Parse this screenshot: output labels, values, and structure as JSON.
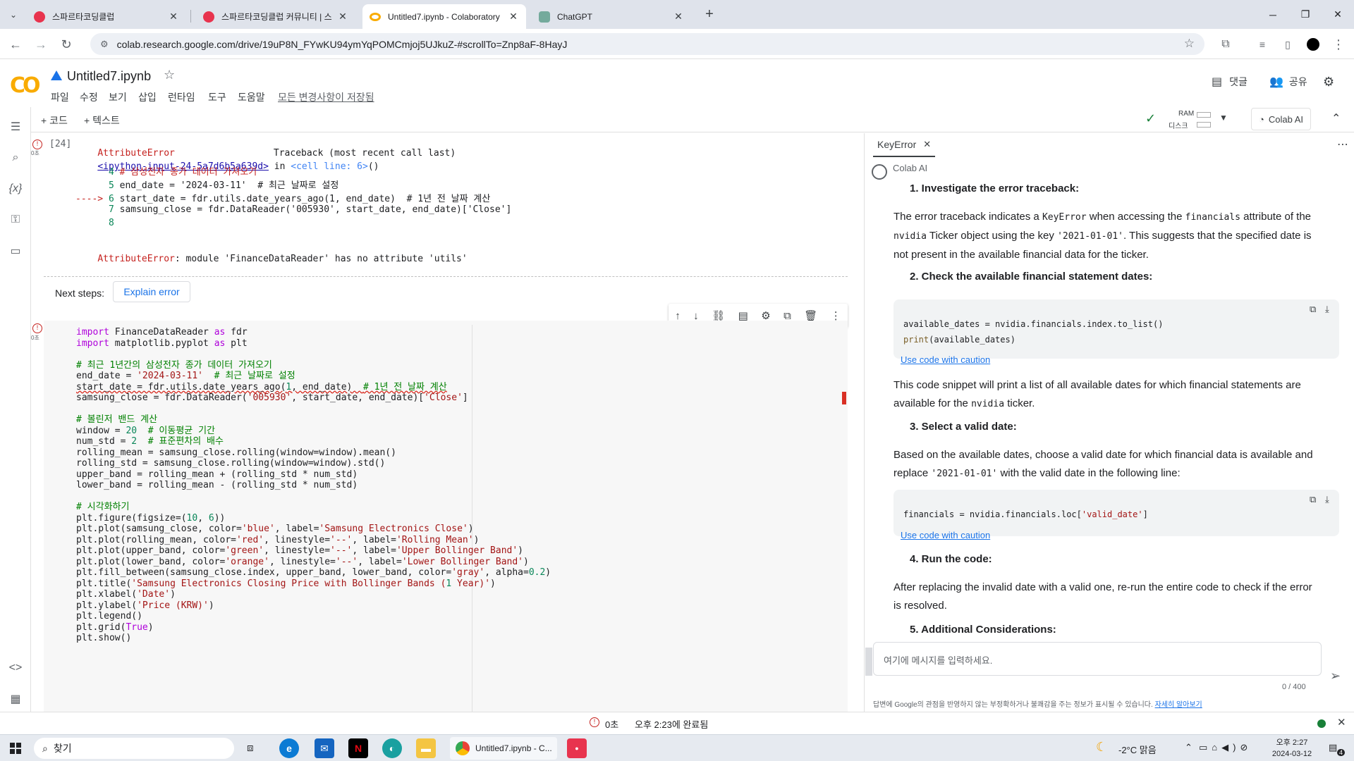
{
  "browser": {
    "tabs": [
      {
        "label": "스파르타코딩클럽",
        "favicon_color": "#e8344e"
      },
      {
        "label": "스파르타코딩클럽 커뮤니티 | 스",
        "favicon_color": "#e8344e"
      },
      {
        "label": "Untitled7.ipynb - Colaboratory",
        "favicon_color": "#f9ab00"
      },
      {
        "label": "ChatGPT",
        "favicon_color": "#74aa9c"
      }
    ],
    "new_tab": "+",
    "url": "colab.research.google.com/drive/19uP8N_FYwKU94ymYqPOMCmjoj5UJkuZ-#scrollTo=Znp8aF-8HayJ"
  },
  "colab": {
    "title": "Untitled7.ipynb",
    "menu": [
      "파일",
      "수정",
      "보기",
      "삽입",
      "런타임",
      "도구",
      "도움말"
    ],
    "saved_status": "모든 변경사항이 저장됨",
    "comments": "댓글",
    "share": "공유",
    "add_code": "+ 코드",
    "add_text": "+ 텍스트",
    "ram": "RAM",
    "disk": "디스크",
    "colab_ai": "Colab AI"
  },
  "cell1": {
    "exec_count": "[24]",
    "exec_time": "0초",
    "error_type": "AttributeError",
    "traceback_label": "Traceback (most recent call last)",
    "input_link": "<ipython-input-24-5a7d6b5a639d>",
    "in_text": " in ",
    "cell_line": "<cell line: 6>",
    "call": "()",
    "lines": [
      {
        "num": "4",
        "arrow": "",
        "code": "# 삼성전자 종가 데이터 가져오기"
      },
      {
        "num": "5",
        "arrow": "",
        "code": "end_date = '2024-03-11'  # 최근 날짜로 설정"
      },
      {
        "num": "6",
        "arrow": "----> ",
        "code": "start_date = fdr.utils.date_years_ago(1, end_date)  # 1년 전 날짜 계산"
      },
      {
        "num": "7",
        "arrow": "",
        "code": "samsung_close = fdr.DataReader('005930', start_date, end_date)['Close']"
      },
      {
        "num": "8",
        "arrow": "",
        "code": ""
      }
    ],
    "error_message_type": "AttributeError",
    "error_message": ": module 'FinanceDataReader' has no attribute 'utils'",
    "next_steps": "Next steps:",
    "explain_error": "Explain error"
  },
  "cell2": {
    "exec_time": "0초",
    "code": [
      "import FinanceDataReader as fdr",
      "import matplotlib.pyplot as plt",
      "",
      "# 최근 1년간의 삼성전자 종가 데이터 가져오기",
      "end_date = '2024-03-11'  # 최근 날짜로 설정",
      "start_date = fdr.utils.date_years_ago(1, end_date)  # 1년 전 날짜 계산",
      "samsung_close = fdr.DataReader('005930', start_date, end_date)['Close']",
      "",
      "# 볼린저 밴드 계산",
      "window = 20  # 이동평균 기간",
      "num_std = 2  # 표준편차의 배수",
      "rolling_mean = samsung_close.rolling(window=window).mean()",
      "rolling_std = samsung_close.rolling(window=window).std()",
      "upper_band = rolling_mean + (rolling_std * num_std)",
      "lower_band = rolling_mean - (rolling_std * num_std)",
      "",
      "# 시각화하기",
      "plt.figure(figsize=(10, 6))",
      "plt.plot(samsung_close, color='blue', label='Samsung Electronics Close')",
      "plt.plot(rolling_mean, color='red', linestyle='--', label='Rolling Mean')",
      "plt.plot(upper_band, color='green', linestyle='--', label='Upper Bollinger Band')",
      "plt.plot(lower_band, color='orange', linestyle='--', label='Lower Bollinger Band')",
      "plt.fill_between(samsung_close.index, upper_band, lower_band, color='gray', alpha=0.2)",
      "plt.title('Samsung Electronics Closing Price with Bollinger Bands (1 Year)')",
      "plt.xlabel('Date')",
      "plt.ylabel('Price (KRW)')",
      "plt.legend()",
      "plt.grid(True)",
      "plt.show()"
    ]
  },
  "panel": {
    "tab_label": "KeyError",
    "assistant_name": "Colab AI",
    "step1": "1. Investigate the error traceback:",
    "p1a": "The error traceback indicates a ",
    "p1_code1": "KeyError",
    "p1b": " when accessing the ",
    "p1_code2": "financials",
    "p1c": " attribute of the",
    "p1_code3": "nvidia",
    "p1d": " Ticker object using the key ",
    "p1_code4": "'2021-01-01'",
    "p1e": ". This suggests that the specified date is",
    "p1f": "not present in the available financial data for the ticker.",
    "step2": "2. Check the available financial statement dates:",
    "code1_line1": "available_dates = nvidia.financials.index.to_list()",
    "code1_line2_fn": "print",
    "code1_line2_rest": "(available_dates)",
    "use_code": "Use code with caution",
    "p2a": "This code snippet will print a list of all available dates for which financial statements are",
    "p2b": "available for the ",
    "p2_code": "nvidia",
    "p2c": " ticker.",
    "step3": "3. Select a valid date:",
    "p3a": "Based on the available dates, choose a valid date for which financial data is available and",
    "p3b": "replace ",
    "p3_code": "'2021-01-01'",
    "p3c": " with the valid date in the following line:",
    "code2_a": "financials = nvidia.financials.loc[",
    "code2_str": "'valid_date'",
    "code2_b": "]",
    "step4": "4. Run the code:",
    "p4a": "After replacing the invalid date with a valid one, re-run the entire code to check if the error",
    "p4b": "is resolved.",
    "step5": "5. Additional Considerations:",
    "input_placeholder": "여기에 메시지를 입력하세요.",
    "char_count": "0 / 400",
    "disclaimer": "답변에 Google의 관점을 반영하지 않는 부정확하거나 불쾌감을 주는 정보가 표시될 수 있습니다. ",
    "learn_more": "자세히 알아보기"
  },
  "status": {
    "errors": "0초",
    "completed": "오후 2:23에 완료됨"
  },
  "taskbar": {
    "search": "찾기",
    "active_app": "Untitled7.ipynb - C...",
    "weather": "-2°C  맑음",
    "time": "오후 2:27",
    "date": "2024-03-12",
    "notif_count": "4"
  }
}
